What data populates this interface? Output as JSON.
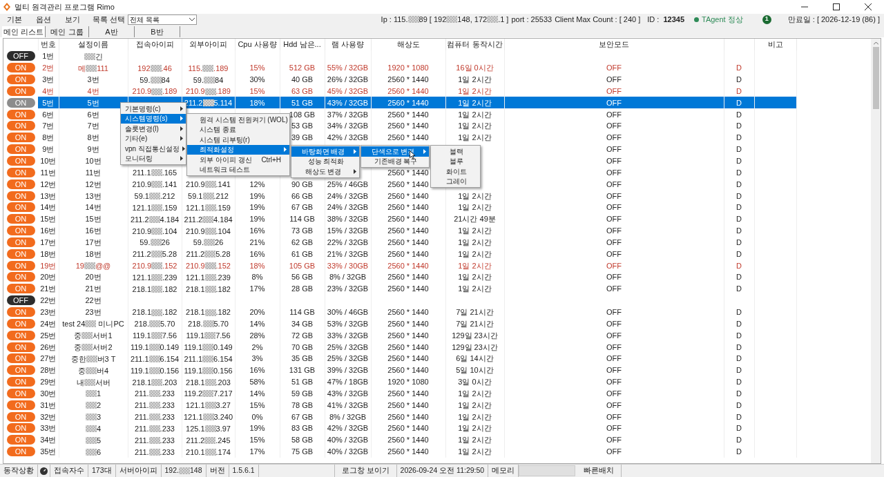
{
  "window": {
    "title": "멀티 원격관리 프로그램 Rimo"
  },
  "menu_bar": {
    "items": [
      "기본",
      "옵션",
      "보기"
    ],
    "list_label": "목록 선택",
    "list_select": "전체 목록"
  },
  "server_info": {
    "ip": {
      "parts": [
        "Ip : 115.",
        "89 [ 192",
        "148, 172",
        ".1 ]"
      ]
    },
    "port": "port : 25533",
    "client_max": "Client Max Count :  [ 240 ]",
    "id_label": "ID :",
    "id": "12345",
    "agent": "TAgent 정상",
    "badge": "1",
    "expiry": "만료일 : [ 2026-12-19 (86) ]"
  },
  "tabs": [
    {
      "label": "메인 리스트",
      "selected": true
    },
    {
      "label": "메인 그룹",
      "selected": false
    },
    {
      "label": "A반",
      "selected": false
    },
    {
      "label": "B반",
      "selected": false
    }
  ],
  "table": {
    "columns": [
      "번호",
      "설정이름",
      "접속아이피",
      "외부아이피",
      "Cpu 사용량",
      "Hdd 남은...",
      "램 사용량",
      "해상도",
      "컴퓨터 동작시간",
      "보안모드",
      "",
      "비고"
    ],
    "rows": [
      {
        "toggle": "OFF",
        "on": false,
        "alert": false,
        "selected": false,
        "no": "1번",
        "name": {
          "parts": [
            "긴"
          ],
          "masked_start": true
        }
      },
      {
        "toggle": "ON",
        "on": true,
        "alert": true,
        "selected": false,
        "no": "2번",
        "name": {
          "parts": [
            "메",
            "111"
          ]
        },
        "ip": {
          "parts": [
            "192",
            ".46"
          ]
        },
        "ext_ip": {
          "parts": [
            "115.",
            ".189"
          ]
        },
        "cpu": "15%",
        "hdd": "512 GB",
        "ram": "55% / 32GB",
        "res": "1920 * 1080",
        "uptime": "16일 0시간",
        "security": "OFF",
        "flag": "D"
      },
      {
        "toggle": "ON",
        "on": true,
        "alert": false,
        "selected": false,
        "no": "3번",
        "name": "3번",
        "ip": {
          "parts": [
            "59.",
            "84"
          ]
        },
        "ext_ip": {
          "parts": [
            "59.",
            "84"
          ]
        },
        "cpu": "30%",
        "hdd": "40 GB",
        "ram": "26% / 32GB",
        "res": "2560 * 1440",
        "uptime": "1일 2시간",
        "security": "OFF",
        "flag": "D"
      },
      {
        "toggle": "ON",
        "on": true,
        "alert": true,
        "selected": false,
        "no": "4번",
        "name": "4번",
        "ip": {
          "parts": [
            "210.9",
            ".189"
          ]
        },
        "ext_ip": {
          "parts": [
            "210.9",
            ".189"
          ]
        },
        "cpu": "15%",
        "hdd": "63 GB",
        "ram": "45% / 32GB",
        "res": "2560 * 1440",
        "uptime": "1일 2시간",
        "security": "OFF",
        "flag": "D"
      },
      {
        "toggle": "ON",
        "on": true,
        "alert": false,
        "selected": true,
        "no": "5번",
        "name": "5번",
        "ext_ip": {
          "parts": [
            "211.2",
            "5.114"
          ]
        },
        "cpu": "18%",
        "hdd": "51 GB",
        "ram": "43% / 32GB",
        "res": "2560 * 1440",
        "uptime": "1일 2시간",
        "security": "OFF",
        "flag": "D"
      },
      {
        "toggle": "ON",
        "on": true,
        "alert": false,
        "selected": false,
        "no": "6번",
        "name": "6번",
        "hdd": "108 GB",
        "ram": "37% / 32GB",
        "res": "2560 * 1440",
        "uptime": "1일 2시간",
        "security": "OFF",
        "flag": "D"
      },
      {
        "toggle": "ON",
        "on": true,
        "alert": false,
        "selected": false,
        "no": "7번",
        "name": "7번",
        "hdd": "53 GB",
        "ram": "34% / 32GB",
        "res": "2560 * 1440",
        "uptime": "1일 2시간",
        "security": "OFF",
        "flag": "D"
      },
      {
        "toggle": "ON",
        "on": true,
        "alert": false,
        "selected": false,
        "no": "8번",
        "name": "8번",
        "hdd": "39 GB",
        "ram": "42% / 32GB",
        "res": "2560 * 1440",
        "uptime": "1일 2시간",
        "security": "OFF",
        "flag": "D"
      },
      {
        "toggle": "ON",
        "on": true,
        "alert": false,
        "selected": false,
        "no": "9번",
        "name": "9번",
        "security": "OFF",
        "flag": "D"
      },
      {
        "toggle": "ON",
        "on": true,
        "alert": false,
        "selected": false,
        "no": "10번",
        "name": "10번",
        "security": "OFF",
        "flag": "D"
      },
      {
        "toggle": "ON",
        "on": true,
        "alert": false,
        "selected": false,
        "no": "11번",
        "name": "11번",
        "ip": {
          "parts": [
            "211.1",
            ".165"
          ]
        },
        "res": "2560 * 1440",
        "security": "OFF",
        "flag": "D"
      },
      {
        "toggle": "ON",
        "on": true,
        "alert": false,
        "selected": false,
        "no": "12번",
        "name": "12번",
        "ip": {
          "parts": [
            "210.9",
            ".141"
          ]
        },
        "ext_ip": {
          "parts": [
            "210.9",
            ".141"
          ]
        },
        "cpu": "12%",
        "hdd": "90 GB",
        "ram": "25% / 46GB",
        "res": "2560 * 1440",
        "security": "OFF",
        "flag": "D"
      },
      {
        "toggle": "ON",
        "on": true,
        "alert": false,
        "selected": false,
        "no": "13번",
        "name": "13번",
        "ip": {
          "parts": [
            "59.1",
            ".212"
          ]
        },
        "ext_ip": {
          "parts": [
            "59.1",
            ".212"
          ]
        },
        "cpu": "19%",
        "hdd": "66 GB",
        "ram": "24% / 32GB",
        "res": "2560 * 1440",
        "uptime": "1일 2시간",
        "security": "OFF",
        "flag": "D"
      },
      {
        "toggle": "ON",
        "on": true,
        "alert": false,
        "selected": false,
        "no": "14번",
        "name": "14번",
        "ip": {
          "parts": [
            "121.1",
            ".159"
          ]
        },
        "ext_ip": {
          "parts": [
            "121.1",
            ".159"
          ]
        },
        "cpu": "19%",
        "hdd": "67 GB",
        "ram": "24% / 32GB",
        "res": "2560 * 1440",
        "uptime": "1일 2시간",
        "security": "OFF",
        "flag": "D"
      },
      {
        "toggle": "ON",
        "on": true,
        "alert": false,
        "selected": false,
        "no": "15번",
        "name": "15번",
        "ip": {
          "parts": [
            "211.2",
            "4.184"
          ]
        },
        "ext_ip": {
          "parts": [
            "211.2",
            "4.184"
          ]
        },
        "cpu": "19%",
        "hdd": "114 GB",
        "ram": "38% / 32GB",
        "res": "2560 * 1440",
        "uptime": "21시간 49분",
        "security": "OFF",
        "flag": "D"
      },
      {
        "toggle": "ON",
        "on": true,
        "alert": false,
        "selected": false,
        "no": "16번",
        "name": "16번",
        "ip": {
          "parts": [
            "210.9",
            ".104"
          ]
        },
        "ext_ip": {
          "parts": [
            "210.9",
            ".104"
          ]
        },
        "cpu": "16%",
        "hdd": "73 GB",
        "ram": "15% / 32GB",
        "res": "2560 * 1440",
        "uptime": "1일 2시간",
        "security": "OFF",
        "flag": "D"
      },
      {
        "toggle": "ON",
        "on": true,
        "alert": false,
        "selected": false,
        "no": "17번",
        "name": "17번",
        "ip": {
          "parts": [
            "59.",
            "26"
          ]
        },
        "ext_ip": {
          "parts": [
            "59.",
            "26"
          ]
        },
        "cpu": "21%",
        "hdd": "62 GB",
        "ram": "22% / 32GB",
        "res": "2560 * 1440",
        "uptime": "1일 2시간",
        "security": "OFF",
        "flag": "D"
      },
      {
        "toggle": "ON",
        "on": true,
        "alert": false,
        "selected": false,
        "no": "18번",
        "name": "18번",
        "ip": {
          "parts": [
            "211.2",
            "5.28"
          ]
        },
        "ext_ip": {
          "parts": [
            "211.2",
            "5.28"
          ]
        },
        "cpu": "16%",
        "hdd": "61 GB",
        "ram": "21% / 32GB",
        "res": "2560 * 1440",
        "uptime": "1일 2시간",
        "security": "OFF",
        "flag": "D"
      },
      {
        "toggle": "ON",
        "on": true,
        "alert": true,
        "selected": false,
        "no": "19번",
        "name": {
          "parts": [
            "19",
            "@@"
          ]
        },
        "ip": {
          "parts": [
            "210.9",
            ".152"
          ]
        },
        "ext_ip": {
          "parts": [
            "210.9",
            ".152"
          ]
        },
        "cpu": "18%",
        "hdd": "105 GB",
        "ram": "33% / 30GB",
        "res": "2560 * 1440",
        "uptime": "1일 2시간",
        "security": "OFF",
        "flag": "D"
      },
      {
        "toggle": "ON",
        "on": true,
        "alert": false,
        "selected": false,
        "no": "20번",
        "name": "20번",
        "ip": {
          "parts": [
            "121.1",
            ".239"
          ]
        },
        "ext_ip": {
          "parts": [
            "121.1",
            ".239"
          ]
        },
        "cpu": "8%",
        "hdd": "56 GB",
        "ram": "8% / 32GB",
        "res": "2560 * 1440",
        "uptime": "1일 2시간",
        "security": "OFF",
        "flag": "D"
      },
      {
        "toggle": "ON",
        "on": true,
        "alert": false,
        "selected": false,
        "no": "21번",
        "name": "21번",
        "ip": {
          "parts": [
            "218.1",
            ".182"
          ]
        },
        "ext_ip": {
          "parts": [
            "218.1",
            ".182"
          ]
        },
        "cpu": "17%",
        "hdd": "28 GB",
        "ram": "23% / 32GB",
        "res": "2560 * 1440",
        "uptime": "1일 2시간",
        "security": "OFF",
        "flag": "D"
      },
      {
        "toggle": "OFF",
        "on": false,
        "alert": false,
        "selected": false,
        "no": "22번",
        "name": "22번"
      },
      {
        "toggle": "ON",
        "on": true,
        "alert": false,
        "selected": false,
        "no": "23번",
        "name": "23번",
        "ip": {
          "parts": [
            "218.1",
            ".182"
          ]
        },
        "ext_ip": {
          "parts": [
            "218.1",
            ".182"
          ]
        },
        "cpu": "20%",
        "hdd": "114 GB",
        "ram": "30% / 46GB",
        "res": "2560 * 1440",
        "uptime": "7일 21시간",
        "security": "OFF",
        "flag": "D"
      },
      {
        "toggle": "ON",
        "on": true,
        "alert": false,
        "selected": false,
        "no": "24번",
        "name": {
          "parts": [
            "test 24",
            " 미니PC"
          ]
        },
        "ip": {
          "parts": [
            "218.",
            "5.70"
          ]
        },
        "ext_ip": {
          "parts": [
            "218.",
            "5.70"
          ]
        },
        "cpu": "14%",
        "hdd": "34 GB",
        "ram": "53% / 32GB",
        "res": "2560 * 1440",
        "uptime": "7일 21시간",
        "security": "OFF",
        "flag": "D"
      },
      {
        "toggle": "ON",
        "on": true,
        "alert": false,
        "selected": false,
        "no": "25번",
        "name": {
          "parts": [
            "중",
            "서버1"
          ]
        },
        "ip": {
          "parts": [
            "119.1",
            "7.56"
          ]
        },
        "ext_ip": {
          "parts": [
            "119.1",
            "7.56"
          ]
        },
        "cpu": "28%",
        "hdd": "72 GB",
        "ram": "33% / 32GB",
        "res": "2560 * 1440",
        "uptime": "129일 23시간",
        "security": "OFF",
        "flag": "D"
      },
      {
        "toggle": "ON",
        "on": true,
        "alert": false,
        "selected": false,
        "no": "26번",
        "name": {
          "parts": [
            "중",
            "서버2"
          ]
        },
        "ip": {
          "parts": [
            "119.1",
            "0.149"
          ]
        },
        "ext_ip": {
          "parts": [
            "119.1",
            "0.149"
          ]
        },
        "cpu": "2%",
        "hdd": "70 GB",
        "ram": "25% / 32GB",
        "res": "2560 * 1440",
        "uptime": "129일 23시간",
        "security": "OFF",
        "flag": "D"
      },
      {
        "toggle": "ON",
        "on": true,
        "alert": false,
        "selected": false,
        "no": "27번",
        "name": {
          "parts": [
            "중한",
            "버3 T"
          ]
        },
        "ip": {
          "parts": [
            "211.1",
            "6.154"
          ]
        },
        "ext_ip": {
          "parts": [
            "211.1",
            "6.154"
          ]
        },
        "cpu": "3%",
        "hdd": "35 GB",
        "ram": "25% / 32GB",
        "res": "2560 * 1440",
        "uptime": "6일 14시간",
        "security": "OFF",
        "flag": "D"
      },
      {
        "toggle": "ON",
        "on": true,
        "alert": false,
        "selected": false,
        "no": "28번",
        "name": {
          "parts": [
            "중",
            "버4"
          ]
        },
        "ip": {
          "parts": [
            "119.1",
            "0.156"
          ]
        },
        "ext_ip": {
          "parts": [
            "119.1",
            "0.156"
          ]
        },
        "cpu": "16%",
        "hdd": "131 GB",
        "ram": "39% / 32GB",
        "res": "2560 * 1440",
        "uptime": "5일 10시간",
        "security": "OFF",
        "flag": "D"
      },
      {
        "toggle": "ON",
        "on": true,
        "alert": false,
        "selected": false,
        "no": "29번",
        "name": {
          "parts": [
            "내",
            "서버"
          ]
        },
        "ip": {
          "parts": [
            "218.1",
            ".203"
          ]
        },
        "ext_ip": {
          "parts": [
            "218.1",
            ".203"
          ]
        },
        "cpu": "58%",
        "hdd": "51 GB",
        "ram": "47% / 18GB",
        "res": "1920 * 1080",
        "uptime": "3일 0시간",
        "security": "OFF",
        "flag": "D"
      },
      {
        "toggle": "ON",
        "on": true,
        "alert": false,
        "selected": false,
        "no": "30번",
        "name": {
          "parts": [
            "1"
          ],
          "masked_start": true
        },
        "ip": {
          "parts": [
            "211.",
            ".233"
          ]
        },
        "ext_ip": {
          "parts": [
            "119.2",
            "7.217"
          ]
        },
        "cpu": "14%",
        "hdd": "59 GB",
        "ram": "43% / 32GB",
        "res": "2560 * 1440",
        "uptime": "1일 2시간",
        "security": "OFF",
        "flag": "D"
      },
      {
        "toggle": "ON",
        "on": true,
        "alert": false,
        "selected": false,
        "no": "31번",
        "name": {
          "parts": [
            "2"
          ],
          "masked_start": true
        },
        "ip": {
          "parts": [
            "211.",
            ".233"
          ]
        },
        "ext_ip": {
          "parts": [
            "121.1",
            "3.27"
          ]
        },
        "cpu": "15%",
        "hdd": "78 GB",
        "ram": "41% / 32GB",
        "res": "2560 * 1440",
        "uptime": "1일 2시간",
        "security": "OFF",
        "flag": "D"
      },
      {
        "toggle": "ON",
        "on": true,
        "alert": false,
        "selected": false,
        "no": "32번",
        "name": {
          "parts": [
            "3"
          ],
          "masked_start": true
        },
        "ip": {
          "parts": [
            "211.",
            ".233"
          ]
        },
        "ext_ip": {
          "parts": [
            "121.1",
            "3.240"
          ]
        },
        "cpu": "0%",
        "hdd": "67 GB",
        "ram": "8% / 32GB",
        "res": "2560 * 1440",
        "uptime": "1일 2시간",
        "security": "OFF",
        "flag": "D"
      },
      {
        "toggle": "ON",
        "on": true,
        "alert": false,
        "selected": false,
        "no": "33번",
        "name": {
          "parts": [
            "4"
          ],
          "masked_start": true
        },
        "ip": {
          "parts": [
            "211.",
            ".233"
          ]
        },
        "ext_ip": {
          "parts": [
            "125.1",
            "3.97"
          ]
        },
        "cpu": "19%",
        "hdd": "83 GB",
        "ram": "42% / 32GB",
        "res": "2560 * 1440",
        "uptime": "1일 2시간",
        "security": "OFF",
        "flag": "D"
      },
      {
        "toggle": "ON",
        "on": true,
        "alert": false,
        "selected": false,
        "no": "34번",
        "name": {
          "parts": [
            "5"
          ],
          "masked_start": true
        },
        "ip": {
          "parts": [
            "211.",
            ".233"
          ]
        },
        "ext_ip": {
          "parts": [
            "211.2",
            ".245"
          ]
        },
        "cpu": "15%",
        "hdd": "58 GB",
        "ram": "40% / 32GB",
        "res": "2560 * 1440",
        "uptime": "1일 2시간",
        "security": "OFF",
        "flag": "D"
      },
      {
        "toggle": "ON",
        "on": true,
        "alert": false,
        "selected": false,
        "no": "35번",
        "name": {
          "parts": [
            "6"
          ],
          "masked_start": true
        },
        "ip": {
          "parts": [
            "211.",
            ".233"
          ]
        },
        "ext_ip": {
          "parts": [
            "210.1",
            ".174"
          ]
        },
        "cpu": "17%",
        "hdd": "75 GB",
        "ram": "40% / 32GB",
        "res": "2560 * 1440",
        "uptime": "1일 2시간",
        "security": "OFF",
        "flag": "D"
      }
    ]
  },
  "context_menus": [
    [
      {
        "label": "기본명령(c)",
        "submenu": true,
        "selected": false
      },
      {
        "label": "시스템명령(s)",
        "submenu": true,
        "selected": true
      },
      {
        "label": "솔룻변경(l)",
        "submenu": true,
        "selected": false
      },
      {
        "label": "기타(e)",
        "submenu": true,
        "selected": false
      },
      {
        "label": "vpn 직접통신설정",
        "submenu": true,
        "selected": false
      },
      {
        "label": "모니터링",
        "submenu": true,
        "selected": false
      }
    ],
    [
      {
        "label": "원격 시스템 전원켜기 (WOL)",
        "submenu": false,
        "selected": false
      },
      {
        "label": "시스템 종료",
        "submenu": false,
        "selected": false
      },
      {
        "label": "시스템 리부팅(r)",
        "submenu": false,
        "selected": false
      },
      {
        "label": "최적화설정",
        "submenu": true,
        "selected": true
      },
      {
        "label": "외부 아이피 갱신",
        "shortcut": "Ctrl+H",
        "submenu": false,
        "selected": false
      },
      {
        "label": "네트워크 테스트",
        "submenu": false,
        "selected": false
      }
    ],
    [
      {
        "label": "바탕화면 배경",
        "submenu": true,
        "selected": true
      },
      {
        "label": "성능 최적화",
        "submenu": false,
        "selected": false
      },
      {
        "label": "해상도 변경",
        "submenu": true,
        "selected": false
      }
    ],
    [
      {
        "label": "단색으로 변경",
        "submenu": true,
        "selected": true
      },
      {
        "label": "기존배경 복구",
        "submenu": false,
        "selected": false
      }
    ],
    [
      {
        "label": "블랙",
        "submenu": false,
        "selected": false
      },
      {
        "label": "블루",
        "submenu": false,
        "selected": false
      },
      {
        "label": "화이트",
        "submenu": false,
        "selected": false
      },
      {
        "label": "그레이",
        "submenu": false,
        "selected": false
      }
    ]
  ],
  "status_bar": [
    {
      "kind": "label",
      "text": "동작상황"
    },
    {
      "kind": "icon"
    },
    {
      "kind": "label",
      "text": "접속자수"
    },
    {
      "kind": "value",
      "text": "173대"
    },
    {
      "kind": "label",
      "text": "서버아이피"
    },
    {
      "kind": "masked",
      "text": {
        "parts": [
          "192.",
          "148"
        ]
      }
    },
    {
      "kind": "label",
      "text": "버전"
    },
    {
      "kind": "value",
      "text": "1.5.6.1"
    },
    {
      "kind": "spacer"
    },
    {
      "kind": "button",
      "text": "로그창 보이기"
    },
    {
      "kind": "value",
      "text": "2026-09-24 오전 11:29:50"
    },
    {
      "kind": "label",
      "text": "메모리"
    },
    {
      "kind": "meter"
    },
    {
      "kind": "button",
      "text": "빠른배치"
    }
  ]
}
